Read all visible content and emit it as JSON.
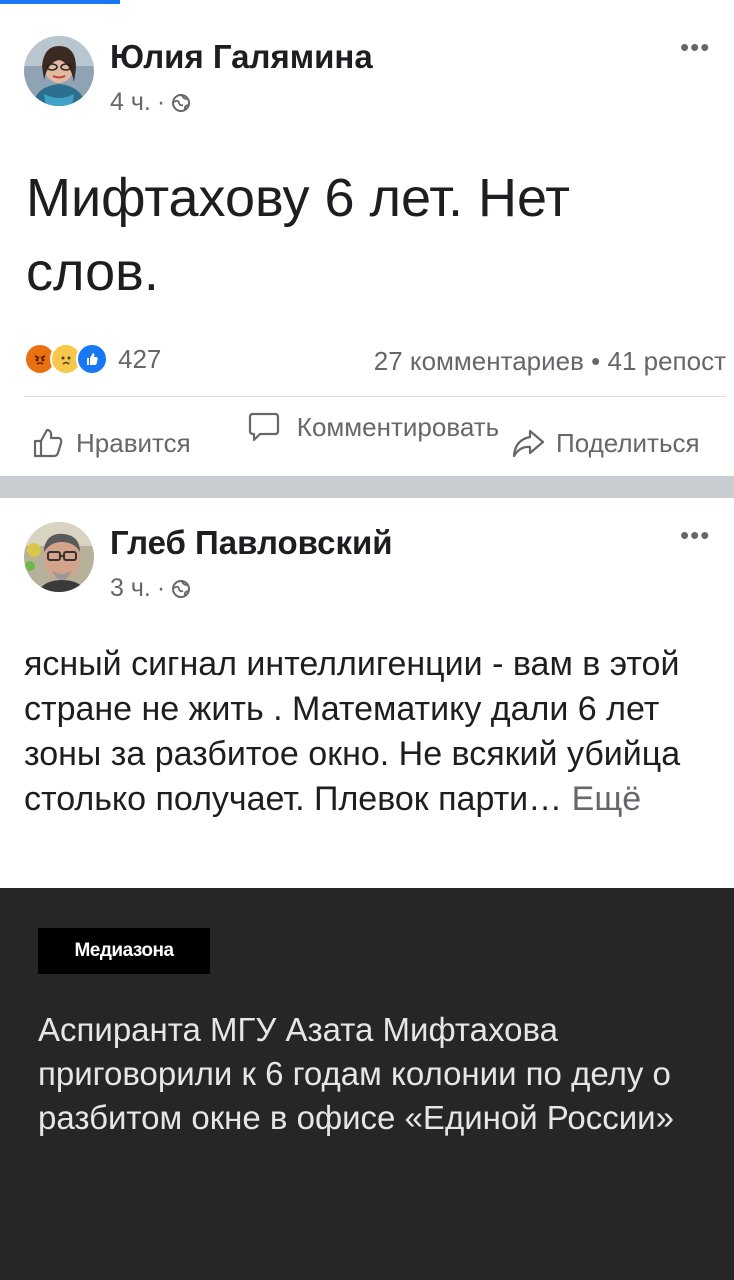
{
  "posts": [
    {
      "author": "Юлия Галямина",
      "time": "4 ч.",
      "separator": "·",
      "more_label": "•••",
      "text": "Мифтахову 6 лет. Нет слов.",
      "reactions": {
        "icons": [
          "angry-reaction-icon",
          "sad-reaction-icon",
          "like-reaction-icon"
        ],
        "count": "427"
      },
      "stats": "27 комментариев • 41 репост",
      "actions": {
        "like": "Нравится",
        "comment": "Комментировать",
        "share": "Поделиться"
      }
    },
    {
      "author": "Глеб Павловский",
      "time": "3 ч.",
      "separator": "·",
      "more_label": "•••",
      "text": "ясный сигнал интеллигенции - вам в этой стране не жить . Математику дали 6 лет зоны за разбитое окно. Не всякий убийца столько получает. Плевок парти…",
      "see_more": "Ещё",
      "link_card": {
        "source": "Медиазона",
        "headline": "Аспиранта МГУ Азата Мифтахова приговорили к 6 годам колонии по делу о разбитом окне в офисе «Единой России»"
      }
    }
  ],
  "colors": {
    "accent": "#1877f2",
    "secondary_text": "#65676b",
    "card_bg": "#262626",
    "separator": "#c9ccd1"
  }
}
